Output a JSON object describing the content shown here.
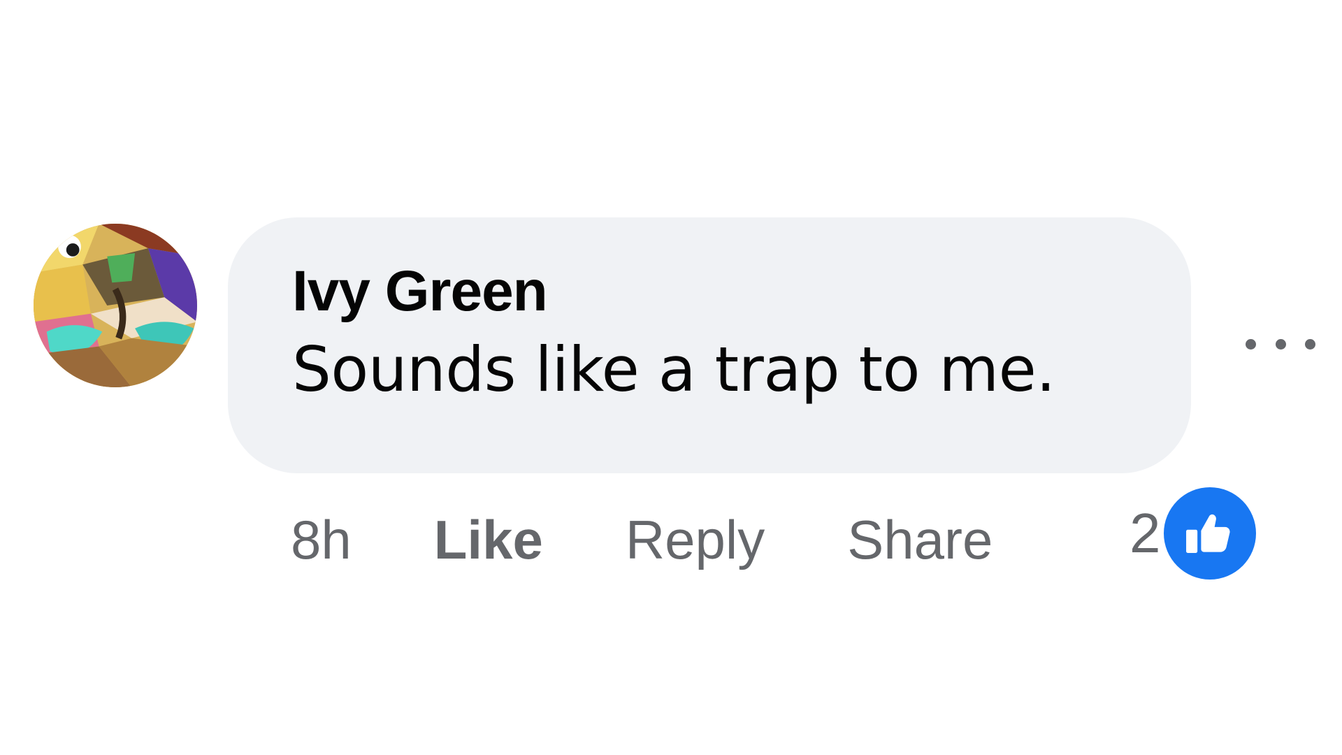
{
  "comment": {
    "author": "Ivy Green",
    "text": "Sounds like a trap to me.",
    "timestamp": "8h",
    "actions": {
      "like": "Like",
      "reply": "Reply",
      "share": "Share"
    },
    "reaction": {
      "count": "2",
      "type": "like-icon",
      "color": "#1877f2"
    },
    "more_menu_icon": "more-options-icon",
    "bubble_color": "#f0f2f5"
  }
}
